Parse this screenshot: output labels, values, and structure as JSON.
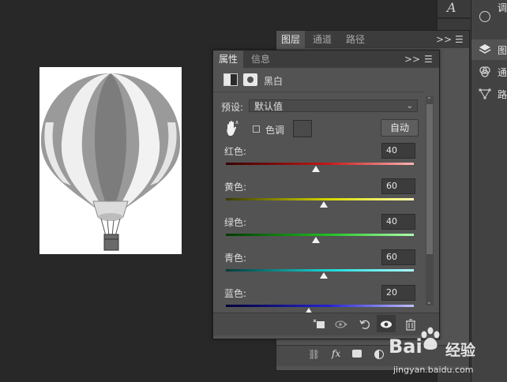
{
  "layers_panel": {
    "tabs": [
      {
        "label": "图层",
        "active": true
      },
      {
        "label": "通道",
        "active": false
      },
      {
        "label": "路径",
        "active": false
      }
    ],
    "menu_glyphs": ">>"
  },
  "properties_panel": {
    "tabs": [
      {
        "label": "属性",
        "active": true
      },
      {
        "label": "信息",
        "active": false
      }
    ],
    "menu_glyphs": ">>",
    "adjustment_name": "黑白",
    "preset_label": "预设:",
    "preset_value": "默认值",
    "tint_label": "色调",
    "tint_checked": false,
    "auto_label": "自动",
    "sliders": [
      {
        "label": "红色:",
        "value": "40",
        "track_from": "#3a0000",
        "track_mid": "#c41a1a",
        "track_to": "#ffb3b3",
        "percent": 0.48
      },
      {
        "label": "黄色:",
        "value": "60",
        "track_from": "#3a3a00",
        "track_mid": "#d8d800",
        "track_to": "#ffffb0",
        "percent": 0.52
      },
      {
        "label": "绿色:",
        "value": "40",
        "track_from": "#003a00",
        "track_mid": "#22c022",
        "track_to": "#b0ffb0",
        "percent": 0.48
      },
      {
        "label": "青色:",
        "value": "60",
        "track_from": "#003a3a",
        "track_mid": "#19d8d8",
        "track_to": "#b0ffff",
        "percent": 0.52
      },
      {
        "label": "蓝色:",
        "value": "20",
        "track_from": "#00003a",
        "track_mid": "#2424d0",
        "track_to": "#c0c0ff",
        "percent": 0.44
      }
    ]
  },
  "dock": {
    "items": [
      {
        "label": "图",
        "icon": "layers-icon"
      },
      {
        "label": "通",
        "icon": "channels-icon"
      },
      {
        "label": "路",
        "icon": "paths-icon"
      }
    ],
    "top_label": "调",
    "percent_1": "%",
    "percent_2": "%"
  },
  "watermark": {
    "brand": "Bai",
    "brand_cn": "经验",
    "url": "jingyan.baidu.com"
  },
  "colors": {
    "workspace": "#282828",
    "panel": "#535353",
    "tab_bar": "#3c3c3c"
  }
}
